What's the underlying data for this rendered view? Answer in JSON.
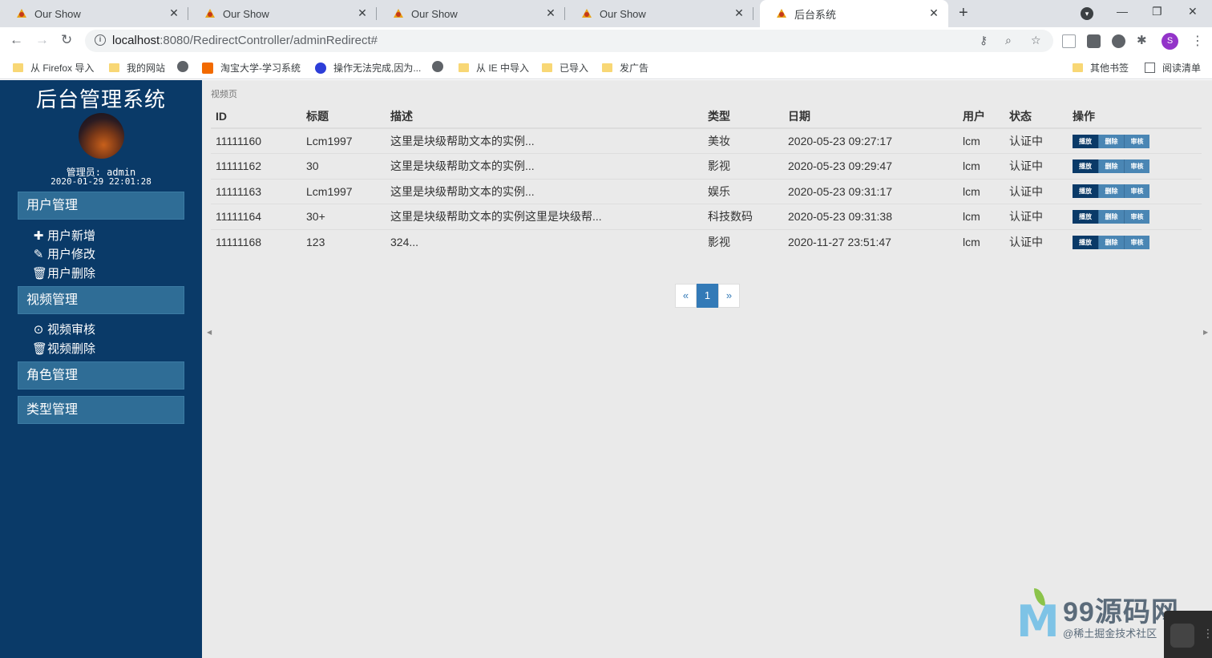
{
  "browser": {
    "tabs": [
      {
        "title": "Our Show"
      },
      {
        "title": "Our Show"
      },
      {
        "title": "Our Show"
      },
      {
        "title": "Our Show"
      },
      {
        "title": "后台系统"
      }
    ],
    "url_host": "localhost",
    "url_path": ":8080/RedirectController/adminRedirect#",
    "profile_initial": "S",
    "bookmarks": [
      {
        "label": "从 Firefox 导入",
        "icon": "folder-icon"
      },
      {
        "label": "我的网站",
        "icon": "folder-icon"
      },
      {
        "label": "",
        "icon": "globe-icon"
      },
      {
        "label": "淘宝大学-学习系统",
        "icon": "taobao-icon"
      },
      {
        "label": "操作无法完成,因为...",
        "icon": "baidu-icon"
      },
      {
        "label": "",
        "icon": "globe-icon"
      },
      {
        "label": "从 IE 中导入",
        "icon": "folder-icon"
      },
      {
        "label": "已导入",
        "icon": "folder-icon"
      },
      {
        "label": "发广告",
        "icon": "folder-icon"
      }
    ],
    "other_bookmarks": "其他书签",
    "reading_list": "阅读清单"
  },
  "sidebar": {
    "title": "后台管理系统",
    "admin_label": "管理员: admin",
    "admin_time": "2020-01-29 22:01:28",
    "menus": [
      {
        "label": "用户管理",
        "items": [
          {
            "label": "用户新增",
            "icon": "plus-icon"
          },
          {
            "label": "用户修改",
            "icon": "pencil-icon"
          },
          {
            "label": "用户删除",
            "icon": "trash-icon"
          }
        ]
      },
      {
        "label": "视频管理",
        "items": [
          {
            "label": "视频审核",
            "icon": "play-circle-icon"
          },
          {
            "label": "视频删除",
            "icon": "trash-icon"
          }
        ]
      },
      {
        "label": "角色管理",
        "items": []
      },
      {
        "label": "类型管理",
        "items": []
      }
    ]
  },
  "main": {
    "breadcrumb": "视频页",
    "columns": [
      "ID",
      "标题",
      "描述",
      "类型",
      "日期",
      "用户",
      "状态",
      "操作"
    ],
    "rows": [
      {
        "id": "11111160",
        "title": "Lcm1997",
        "desc": "这里是块级帮助文本的实例...",
        "type": "美妆",
        "date": "2020-05-23 09:27:17",
        "user": "lcm",
        "status": "认证中"
      },
      {
        "id": "11111162",
        "title": "30",
        "desc": "这里是块级帮助文本的实例...",
        "type": "影视",
        "date": "2020-05-23 09:29:47",
        "user": "lcm",
        "status": "认证中"
      },
      {
        "id": "11111163",
        "title": "Lcm1997",
        "desc": "这里是块级帮助文本的实例...",
        "type": "娱乐",
        "date": "2020-05-23 09:31:17",
        "user": "lcm",
        "status": "认证中"
      },
      {
        "id": "11111164",
        "title": "30+",
        "desc": "这里是块级帮助文本的实例这里是块级帮...",
        "type": "科技数码",
        "date": "2020-05-23 09:31:38",
        "user": "lcm",
        "status": "认证中"
      },
      {
        "id": "11111168",
        "title": "123",
        "desc": "324...",
        "type": "影视",
        "date": "2020-11-27 23:51:47",
        "user": "lcm",
        "status": "认证中"
      }
    ],
    "op_labels": {
      "play": "播放",
      "delete": "删除",
      "audit": "审核"
    },
    "pagination": {
      "prev": "«",
      "current": "1",
      "next": "»"
    }
  },
  "watermark": {
    "brand": "99源码网",
    "sub": "@稀土掘金技术社区"
  }
}
